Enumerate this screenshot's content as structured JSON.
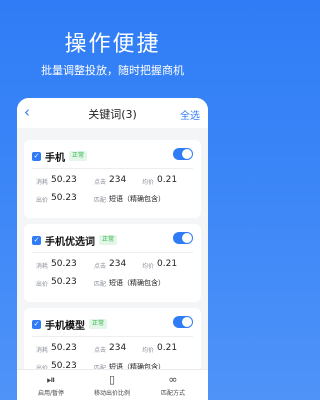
{
  "promo": {
    "title": "操作便捷",
    "subtitle": "批量调整投放，随时把握商机"
  },
  "nav": {
    "back_icon": "chevron-left-icon",
    "title": "关键词(3)",
    "select_all": "全选"
  },
  "labels": {
    "cost": "消耗",
    "clicks": "点击",
    "avg_price": "均价",
    "bid": "出价",
    "match": "匹配"
  },
  "keywords": [
    {
      "name": "手机",
      "status": "正常",
      "cost": "50.23",
      "clicks": "234",
      "avg_price": "0.21",
      "bid": "50.23",
      "match": "短语（精确包含）"
    },
    {
      "name": "手机优选词",
      "status": "正常",
      "cost": "50.23",
      "clicks": "234",
      "avg_price": "0.21",
      "bid": "50.23",
      "match": "短语（精确包含）"
    },
    {
      "name": "手机模型",
      "status": "正常",
      "cost": "50.23",
      "clicks": "234",
      "avg_price": "0.21",
      "bid": "50.23",
      "match": "短语（精确包含）"
    }
  ],
  "tabbar": [
    {
      "icon": "pause-play-icon",
      "label": "启用/暂停"
    },
    {
      "icon": "phone-bid-icon",
      "label": "移动出价比例"
    },
    {
      "icon": "link-match-icon",
      "label": "匹配方式"
    }
  ],
  "colors": {
    "accent": "#2f7cf6",
    "status_green": "#2fb34b"
  }
}
